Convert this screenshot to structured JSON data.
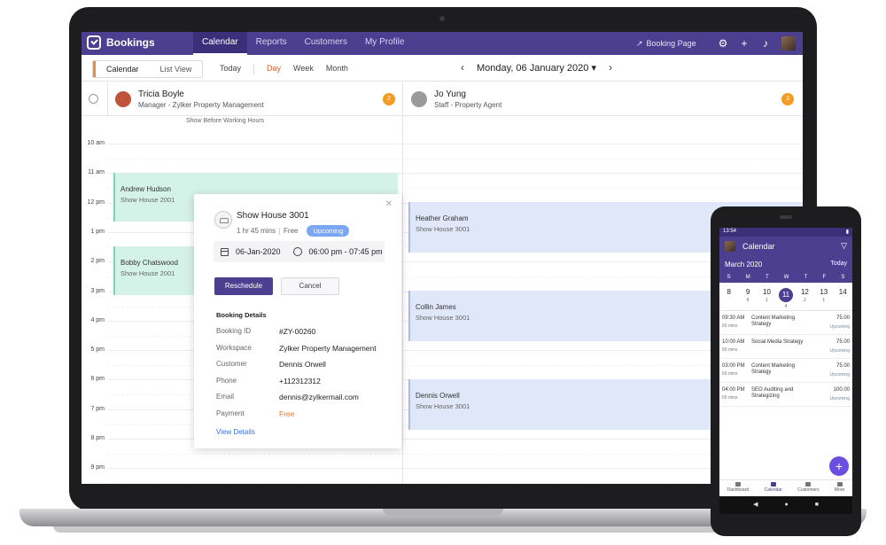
{
  "app": {
    "name": "Bookings",
    "booking_page": "Booking Page"
  },
  "nav": [
    "Calendar",
    "Reports",
    "Customers",
    "My Profile"
  ],
  "toolbar": {
    "seg": [
      "Calendar",
      "List View"
    ],
    "modes": [
      "Today",
      "Day",
      "Week",
      "Month"
    ],
    "date": "Monday, 06 January 2020"
  },
  "staff": [
    {
      "name": "Tricia Boyle",
      "role": "Manager - Zylker Property Management",
      "count": "2",
      "color": "#c0543b"
    },
    {
      "name": "Jo Yung",
      "role": "Staff - Property Agent",
      "count": "3",
      "color": "#9a9a9a"
    }
  ],
  "show_before": "Show Before Working Hours",
  "hours": [
    "10 am",
    "11 am",
    "12 pm",
    "1 pm",
    "2 pm",
    "3 pm",
    "4 pm",
    "5 pm",
    "6 pm",
    "7 pm",
    "8 pm",
    "9 pm"
  ],
  "events": [
    {
      "name": "Andrew Hudson",
      "service": "Show House 2001"
    },
    {
      "name": "Bobby Chatswood",
      "service": "Show House 2001"
    },
    {
      "name": "Heather Graham",
      "service": "Show House 3001"
    },
    {
      "name": "Collin James",
      "service": "Show House 3001"
    },
    {
      "name": "Dennis Orwell",
      "service": "Show House 3001"
    }
  ],
  "popup": {
    "title": "Show House 3001",
    "duration": "1 hr 45 mins",
    "price": "Free",
    "status": "Upcoming",
    "date": "06-Jan-2020",
    "time": "06:00 pm - 07:45 pm",
    "reschedule": "Reschedule",
    "cancel": "Cancel",
    "details_title": "Booking Details",
    "details": [
      {
        "label": "Booking ID",
        "value": "#ZY-00260"
      },
      {
        "label": "Workspace",
        "value": "Zylker Property Management"
      },
      {
        "label": "Customer",
        "value": "Dennis Orwell"
      },
      {
        "label": "Phone",
        "value": "+112312312"
      },
      {
        "label": "Email",
        "value": "dennis@zylkermail.com"
      },
      {
        "label": "Payment",
        "value": "Free"
      }
    ],
    "view_details": "View Details"
  },
  "phone": {
    "status_time": "13:54",
    "title": "Calendar",
    "month": "March 2020",
    "today": "Today",
    "weekdays": [
      "S",
      "M",
      "T",
      "W",
      "T",
      "F",
      "S"
    ],
    "dates": [
      {
        "d": "8",
        "c": ""
      },
      {
        "d": "9",
        "c": "6"
      },
      {
        "d": "10",
        "c": "1"
      },
      {
        "d": "11",
        "c": "4"
      },
      {
        "d": "12",
        "c": "2"
      },
      {
        "d": "13",
        "c": "1"
      },
      {
        "d": "14",
        "c": ""
      }
    ],
    "items": [
      {
        "time": "09:30 AM",
        "dur": "60 mins",
        "name": "Content Marketing Strategy",
        "price": "75.00",
        "status": "Upcoming"
      },
      {
        "time": "10:00 AM",
        "dur": "60 mins",
        "name": "Social Media Strategy",
        "price": "75.00",
        "status": "Upcoming"
      },
      {
        "time": "03:00 PM",
        "dur": "60 mins",
        "name": "Content Marketing Strategy",
        "price": "75.00",
        "status": "Upcoming"
      },
      {
        "time": "04:00 PM",
        "dur": "60 mins",
        "name": "SEO Auditing and Strategizing",
        "price": "100.00",
        "status": "Upcoming"
      }
    ],
    "tabs": [
      "Dashboard",
      "Calendar",
      "Customers",
      "More"
    ]
  }
}
